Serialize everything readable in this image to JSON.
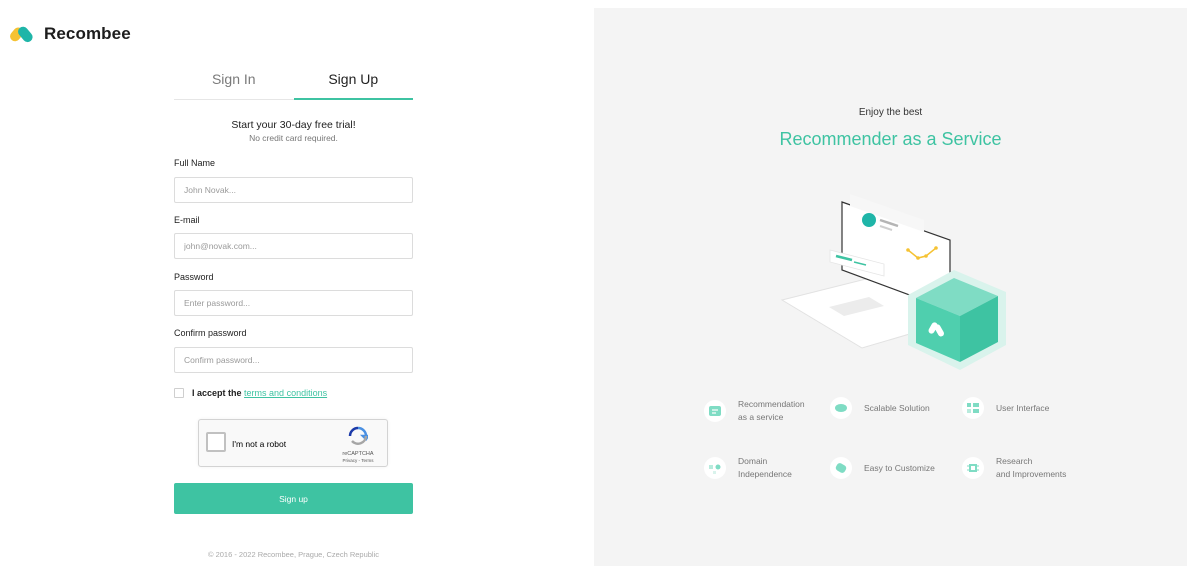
{
  "brand": {
    "name": "Recombee"
  },
  "tabs": [
    {
      "label": "Sign In"
    },
    {
      "label": "Sign Up"
    }
  ],
  "promo": {
    "title": "Start your 30-day free trial!",
    "subtitle": "No credit card required."
  },
  "form": {
    "full_name": {
      "label": "Full Name",
      "placeholder": "John Novak..."
    },
    "email": {
      "label": "E-mail",
      "placeholder": "john@novak.com..."
    },
    "password": {
      "label": "Password",
      "placeholder": "Enter password..."
    },
    "confirm": {
      "label": "Confirm password",
      "placeholder": "Confirm password..."
    },
    "accept_prefix": "I accept the",
    "terms_link": "terms and conditions",
    "submit": "Sign up"
  },
  "captcha": {
    "label": "I'm not a robot",
    "brand": "reCAPTCHA",
    "links": "Privacy - Terms"
  },
  "footer": "© 2016 - 2022 Recombee, Prague, Czech Republic",
  "hero": {
    "eyebrow": "Enjoy the best",
    "title": "Recommender as a Service"
  },
  "features": [
    {
      "text": "Recommendation\nas a service",
      "icon": "recommendation-icon"
    },
    {
      "text": "Scalable Solution",
      "icon": "scalable-icon"
    },
    {
      "text": "User Interface",
      "icon": "user-interface-icon"
    },
    {
      "text": "Domain\nIndependence",
      "icon": "domain-icon"
    },
    {
      "text": "Easy to Customize",
      "icon": "customize-icon"
    },
    {
      "text": "Research\nand Improvements",
      "icon": "research-icon"
    }
  ],
  "colors": {
    "accent": "#3ec3a2",
    "panel": "#f4f4f4",
    "logo_yellow": "#f5c232",
    "logo_teal": "#1fb5a8"
  }
}
